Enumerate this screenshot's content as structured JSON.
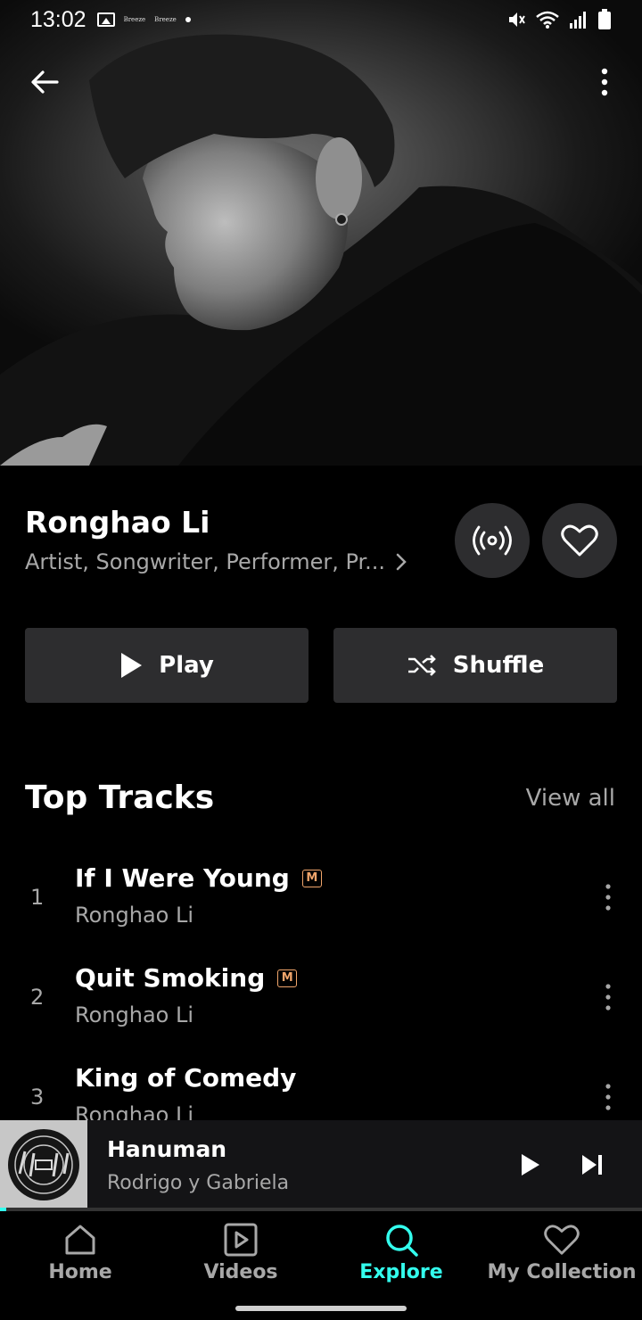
{
  "status_bar": {
    "time": "13:02",
    "left_icons": [
      "image-icon",
      "breeze-icon",
      "breeze-icon",
      "dot-icon"
    ],
    "breeze_label": "Breeze",
    "right_icons": [
      "mute-icon",
      "wifi-icon",
      "signal-icon",
      "battery-icon"
    ]
  },
  "header": {
    "back_icon": "arrow-left-icon",
    "more_icon": "more-vertical-icon"
  },
  "artist": {
    "name": "Ronghao Li",
    "roles": "Artist, Songwriter, Performer, Pr...",
    "radio_icon": "broadcast-icon",
    "favorite_icon": "heart-icon"
  },
  "actions": {
    "play_label": "Play",
    "shuffle_label": "Shuffle"
  },
  "top_tracks": {
    "title": "Top Tracks",
    "view_all": "View all",
    "items": [
      {
        "number": "1",
        "title": "If I Were Young",
        "badge": "M",
        "artist": "Ronghao Li"
      },
      {
        "number": "2",
        "title": "Quit Smoking",
        "badge": "M",
        "artist": "Ronghao Li"
      },
      {
        "number": "3",
        "title": "King of Comedy",
        "badge": "",
        "artist": "Ronghao Li"
      }
    ]
  },
  "now_playing": {
    "title": "Hanuman",
    "artist": "Rodrigo y Gabriela",
    "progress": 0.01
  },
  "bottom_nav": {
    "items": [
      {
        "label": "Home",
        "icon": "home-icon",
        "active": false
      },
      {
        "label": "Videos",
        "icon": "video-icon",
        "active": false
      },
      {
        "label": "Explore",
        "icon": "search-icon",
        "active": true
      },
      {
        "label": "My Collection",
        "icon": "heart-icon",
        "active": false
      }
    ]
  },
  "colors": {
    "accent": "#33ffee",
    "background": "#000000",
    "surface": "#2d2d2f",
    "secondary_text": "#a8a8a8",
    "mq_badge": "#f0a56b"
  }
}
